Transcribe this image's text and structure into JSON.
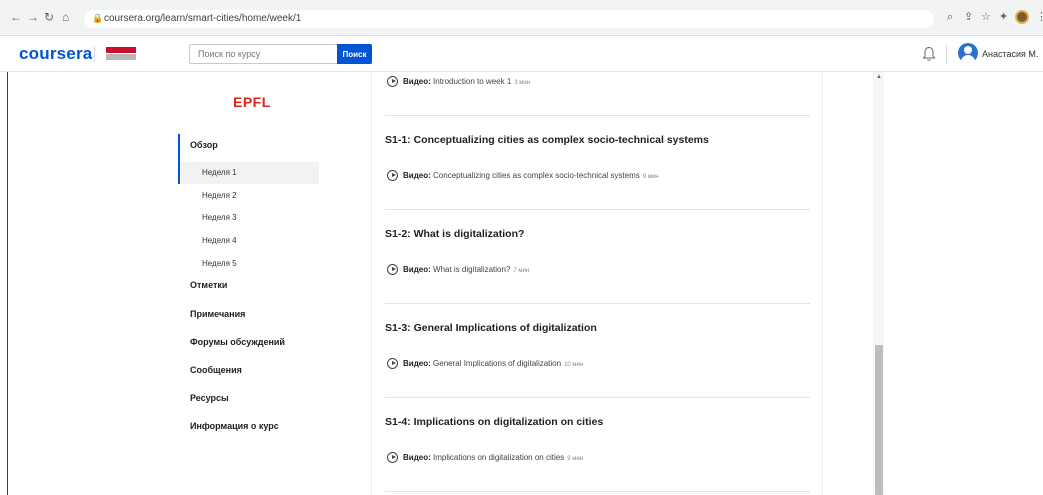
{
  "browser": {
    "url": "coursera.org/learn/smart-cities/home/week/1"
  },
  "header": {
    "logo_text": "coursera",
    "search_placeholder": "Поиск по курсу",
    "search_button": "Поиск",
    "user_name": "Анастасия М."
  },
  "sidebar": {
    "partner_logo": "EPFL",
    "overview": "Обзор",
    "weeks": [
      "Неделя 1",
      "Неделя 2",
      "Неделя 3",
      "Неделя 4",
      "Неделя 5"
    ],
    "items": [
      "Отметки",
      "Примечания",
      "Форумы обсуждений",
      "Сообщения",
      "Ресурсы",
      "Информация о курс"
    ]
  },
  "main": {
    "video_prefix": "Видео:",
    "intro_video": {
      "title": "Introduction to week 1",
      "duration": "3 мин"
    },
    "sections": [
      {
        "title": "S1-1: Conceptualizing cities as complex socio-technical systems",
        "video": "Conceptualizing cities as complex socio-technical systems",
        "duration": "9 мин"
      },
      {
        "title": "S1-2: What is digitalization?",
        "video": "What is digitalization?",
        "duration": "7 мин"
      },
      {
        "title": "S1-3: General Implications of digitalization",
        "video": "General Implications of digitalization",
        "duration": "10 мин"
      },
      {
        "title": "S1-4: Implications on digitalization on cities",
        "video": "Implications on digitalization on cities",
        "duration": "9 мин"
      }
    ]
  },
  "colors": {
    "brand_blue": "#0056d2",
    "epfl_red": "#e2231a"
  }
}
